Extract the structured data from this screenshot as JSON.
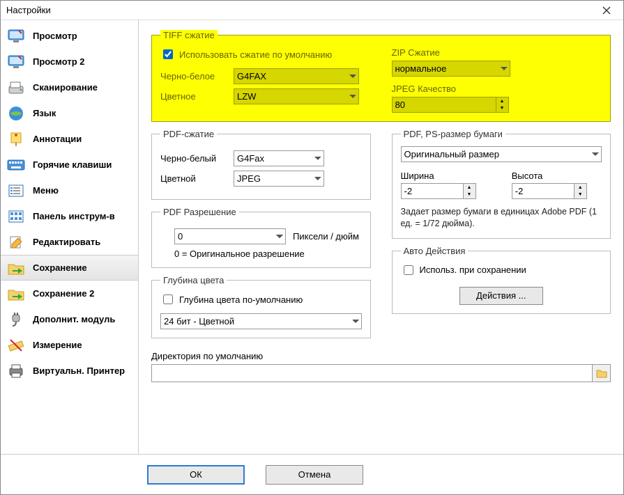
{
  "window": {
    "title": "Настройки"
  },
  "sidebar": {
    "items": [
      {
        "label": "Просмотр"
      },
      {
        "label": "Просмотр 2"
      },
      {
        "label": "Сканирование"
      },
      {
        "label": "Язык"
      },
      {
        "label": "Аннотации"
      },
      {
        "label": "Горячие клавиши"
      },
      {
        "label": "Меню"
      },
      {
        "label": "Панель инструм-в"
      },
      {
        "label": "Редактировать"
      },
      {
        "label": "Сохранение"
      },
      {
        "label": "Сохранение 2"
      },
      {
        "label": "Дополнит. модуль"
      },
      {
        "label": "Измерение"
      },
      {
        "label": "Виртуальн. Принтер"
      }
    ]
  },
  "tiff": {
    "legend": "TIFF сжатие",
    "use_default_label": "Использовать сжатие по умолчанию",
    "use_default_checked": true,
    "bw_label": "Черно-белое",
    "bw_value": "G4FAX",
    "color_label": "Цветное",
    "color_value": "LZW",
    "zip_label": "ZIP Сжатие",
    "zip_value": "нормальное",
    "jpeg_q_label": "JPEG Качество",
    "jpeg_q_value": "80"
  },
  "pdfc": {
    "legend": "PDF-сжатие",
    "bw_label": "Черно-белый",
    "bw_value": "G4Fax",
    "color_label": "Цветной",
    "color_value": "JPEG"
  },
  "pdfres": {
    "legend": "PDF Разрешение",
    "value": "0",
    "unit": "Пиксели / дюйм",
    "note": "0 = Оригинальное разрешение"
  },
  "paper": {
    "legend": "PDF, PS-размер бумаги",
    "size_value": "Оригинальный размер",
    "w_label": "Ширина",
    "w_value": "-2",
    "h_label": "Высота",
    "h_value": "-2",
    "note": "Задает размер бумаги в единицах Adobe PDF (1 ед. = 1/72 дюйма)."
  },
  "depth": {
    "legend": "Глубина цвета",
    "default_label": "Глубина цвета по-умолчанию",
    "default_checked": false,
    "value": "24 бит - Цветной"
  },
  "auto": {
    "legend": "Авто Действия",
    "use_label": "Использ. при сохранении",
    "use_checked": false,
    "button": "Действия ..."
  },
  "dir": {
    "label": "Директория по умолчанию",
    "value": ""
  },
  "footer": {
    "ok": "ОК",
    "cancel": "Отмена"
  }
}
